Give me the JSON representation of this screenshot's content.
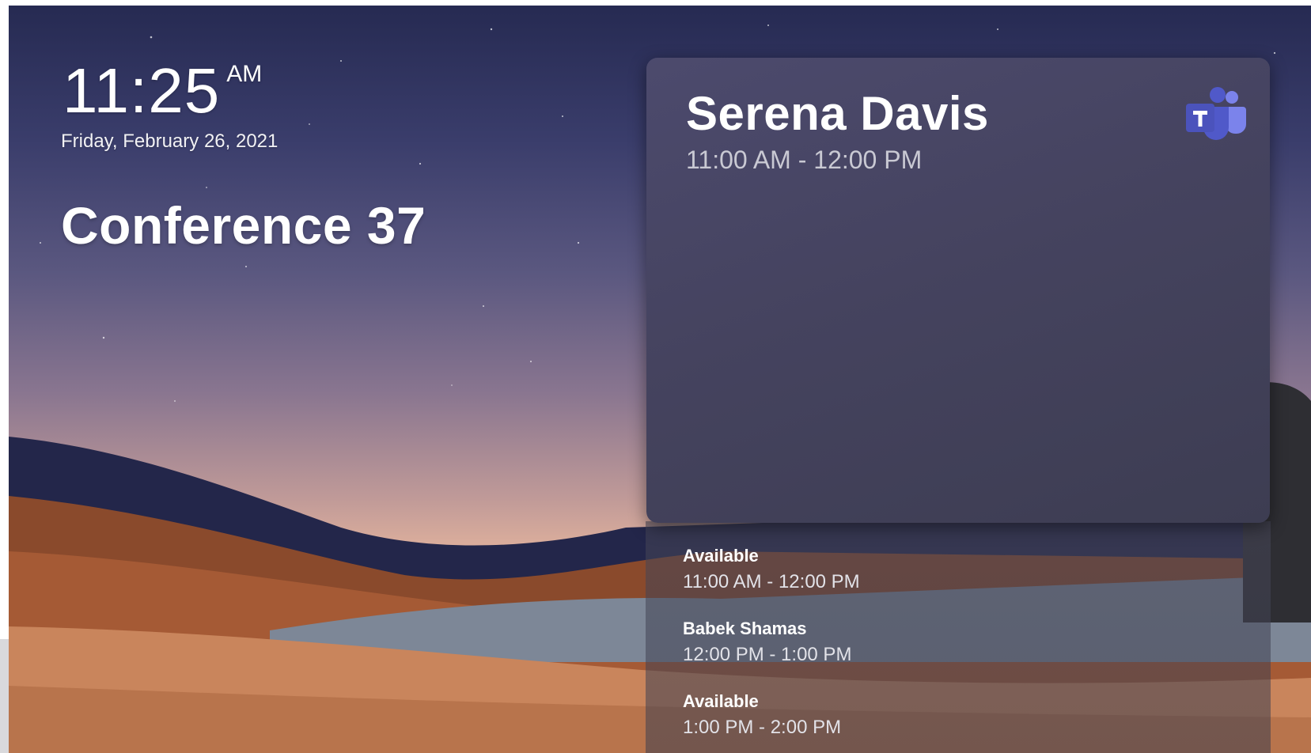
{
  "clock": {
    "time": "11:25",
    "ampm": "AM",
    "date": "Friday, February 26, 2021"
  },
  "room": {
    "name": "Conference 37"
  },
  "current_meeting": {
    "organizer": "Serena Davis",
    "time": "11:00 AM - 12:00 PM",
    "app_icon": "microsoft-teams-icon"
  },
  "schedule": [
    {
      "title": "Available",
      "time": "11:00 AM - 12:00 PM"
    },
    {
      "title": "Babek Shamas",
      "time": "12:00 PM - 1:00 PM"
    },
    {
      "title": "Available",
      "time": "1:00 PM - 2:00 PM"
    }
  ],
  "colors": {
    "teams_brand": "#5059c9",
    "card_bg": "#45435f"
  }
}
